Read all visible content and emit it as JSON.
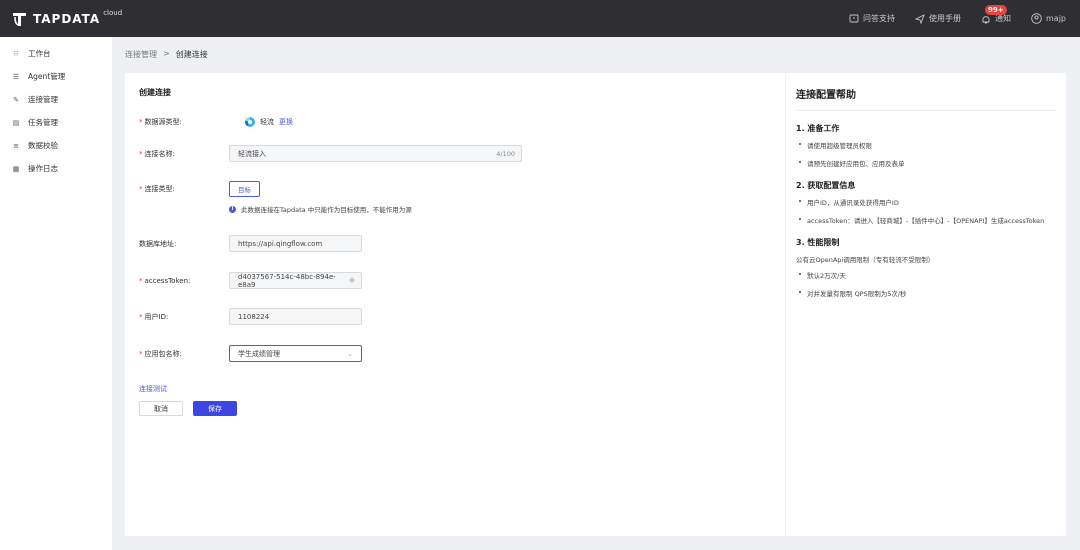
{
  "header": {
    "brand": "TAPDATA",
    "brand_sub": "cloud",
    "support": "问答支持",
    "manual": "使用手册",
    "notify": "通知",
    "notify_badge": "99+",
    "user": "majp"
  },
  "sidebar": {
    "items": [
      {
        "label": "工作台",
        "icon": "dashboard-icon"
      },
      {
        "label": "Agent管理",
        "icon": "list-icon"
      },
      {
        "label": "连接管理",
        "icon": "link-icon"
      },
      {
        "label": "任务管理",
        "icon": "task-icon"
      },
      {
        "label": "数据校验",
        "icon": "check-icon"
      },
      {
        "label": "操作日志",
        "icon": "log-icon"
      }
    ]
  },
  "breadcrumb": {
    "parent": "连接管理",
    "separator": ">",
    "current": "创建连接"
  },
  "form": {
    "title": "创建连接",
    "source_type_label": "数据源类型:",
    "source_type_value": "轻流",
    "source_type_change": "更换",
    "name_label": "连接名称:",
    "name_value": "轻流接入",
    "name_count": "4/100",
    "conn_type_label": "连接类型:",
    "conn_type_value": "目标",
    "conn_type_hint": "此数据连接在Tapdata 中只能作为目标使用，不能作用为源",
    "db_addr_label": "数据库地址:",
    "db_addr_value": "https://api.qingflow.com",
    "token_label": "accessToken:",
    "token_value": "d4037567-514c-48bc-894e-e8a9",
    "user_id_label": "用户ID:",
    "user_id_value": "1108224",
    "app_label": "应用包名称:",
    "app_value": "学生成绩管理",
    "test_link": "连接测试",
    "cancel": "取消",
    "save": "保存"
  },
  "help": {
    "title": "连接配置帮助",
    "s1_title": "1. 准备工作",
    "s1_items": [
      "请使用超级管理员权限",
      "请预先创建好应用包、应用及表单"
    ],
    "s2_title": "2. 获取配置信息",
    "s2_items": [
      "用户ID，从通讯录处获得用户ID",
      "accessToken：请进入【轻商城】-【插件中心】-【OPENAPI】生成accessToken"
    ],
    "s3_title": "3. 性能限制",
    "s3_desc": "公有云OpenApi调用限制（专有轻流不受限制）",
    "s3_items": [
      "默认2万次/天",
      "对并发量有限制 QPS限制为5次/秒"
    ]
  },
  "colors": {
    "accent": "#3c46e0",
    "topbar": "#2f2f33",
    "required": "#e8433c"
  }
}
